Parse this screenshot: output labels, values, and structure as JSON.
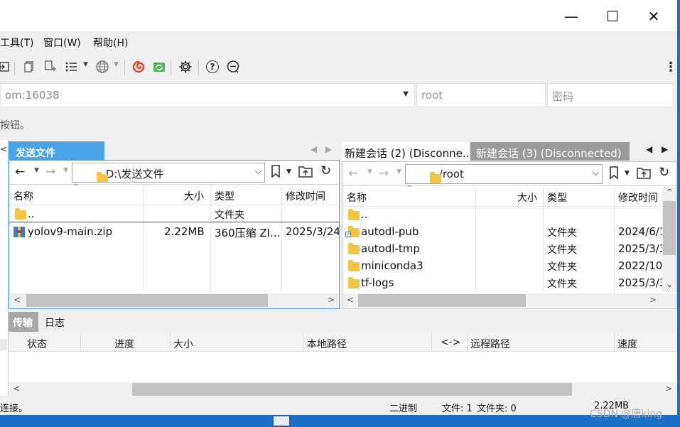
{
  "window": {
    "minimize_glyph": "—",
    "maximize_glyph": "☐",
    "close_glyph": "✕"
  },
  "menu": [
    "工具(T)",
    "窗口(W)",
    "帮助(H)"
  ],
  "toolbar": {
    "icons": [
      "login-icon",
      "copy-icon",
      "duplicate-icon",
      "list-icon",
      "globe-icon",
      "swirl-icon",
      "sync-icon",
      "gear-icon",
      "help-icon",
      "chat-icon",
      "more-icon"
    ]
  },
  "connection": {
    "host_value": "om:16038",
    "user_placeholder": "root",
    "password_placeholder": "密码"
  },
  "hint": "按钮。",
  "left_pane": {
    "tab_label": "发送文件",
    "path": "D:\\发送文件",
    "columns": [
      "名称",
      "大小",
      "类型",
      "修改时间"
    ],
    "rows": [
      {
        "name": "..",
        "size": "",
        "type": "文件夹",
        "modified": ""
      },
      {
        "name": "yolov9-main.zip",
        "size": "2.22MB",
        "type": "360压缩 ZI...",
        "modified": "2025/3/24"
      }
    ]
  },
  "right_pane": {
    "tabs": [
      "新建会话 (2) (Disconne...",
      "新建会话 (3) (Disconnected)"
    ],
    "path": "/root",
    "columns": [
      "名称",
      "大小",
      "类型",
      "修改时间"
    ],
    "rows": [
      {
        "name": "..",
        "size": "",
        "type": "",
        "modified": ""
      },
      {
        "name": "autodl-pub",
        "size": "",
        "type": "文件夹",
        "modified": "2024/6/1"
      },
      {
        "name": "autodl-tmp",
        "size": "",
        "type": "文件夹",
        "modified": "2025/3/3"
      },
      {
        "name": "miniconda3",
        "size": "",
        "type": "文件夹",
        "modified": "2022/10"
      },
      {
        "name": "tf-logs",
        "size": "",
        "type": "文件夹",
        "modified": "2025/3/3"
      }
    ]
  },
  "bottom": {
    "tabs": [
      "传输",
      "日志"
    ],
    "columns": [
      "状态",
      "进度",
      "大小",
      "本地路径",
      "<->",
      "远程路径",
      "速度"
    ]
  },
  "status": {
    "left": "连接。",
    "mode": "二进制",
    "files": "文件: 1",
    "folders": "文件夹: 0",
    "size": "2.22MB"
  },
  "watermark": "CSDN @唐king"
}
